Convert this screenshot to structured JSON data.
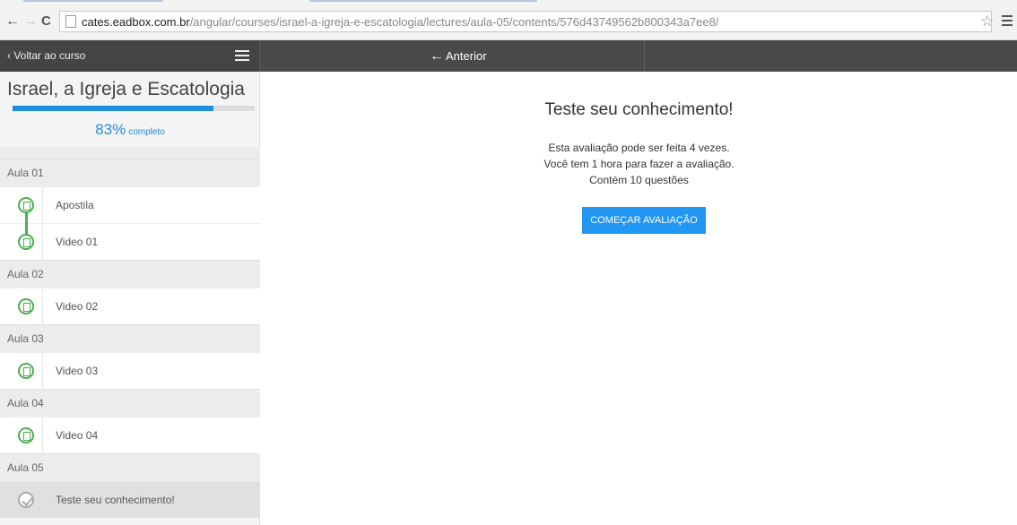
{
  "browser": {
    "url_host": "cates.eadbox.com.br",
    "url_path": "/angular/courses/israel-a-igreja-e-escatologia/lectures/aula-05/contents/576d43749562b800343a7ee8/"
  },
  "topbar": {
    "back_label": "Voltar ao curso",
    "prev_label": "Anterior"
  },
  "sidebar": {
    "course_title": "Israel, a Igreja e Escatologia",
    "progress_percent": 83,
    "progress_text": "83%",
    "progress_label": "completo",
    "lessons": [
      {
        "title": "Aula 01",
        "items": [
          {
            "label": "Apostila"
          },
          {
            "label": "Video 01"
          }
        ]
      },
      {
        "title": "Aula 02",
        "items": [
          {
            "label": "Video 02"
          }
        ]
      },
      {
        "title": "Aula 03",
        "items": [
          {
            "label": "Video 03"
          }
        ]
      },
      {
        "title": "Aula 04",
        "items": [
          {
            "label": "Video 04"
          }
        ]
      },
      {
        "title": "Aula 05",
        "items": [
          {
            "label": "Teste seu conhecimento!"
          }
        ]
      }
    ]
  },
  "main": {
    "title": "Teste seu conhecimento!",
    "info_line1": "Esta avaliação pode ser feita 4 vezes.",
    "info_line2": "Você tem 1 hora para fazer a avaliação.",
    "info_line3": "Contém 10 questões",
    "start_button": "COMEÇAR AVALIAÇÃO"
  },
  "colors": {
    "accent": "#2196f3",
    "complete": "#4caf50",
    "topbar": "#4a4a4a"
  }
}
